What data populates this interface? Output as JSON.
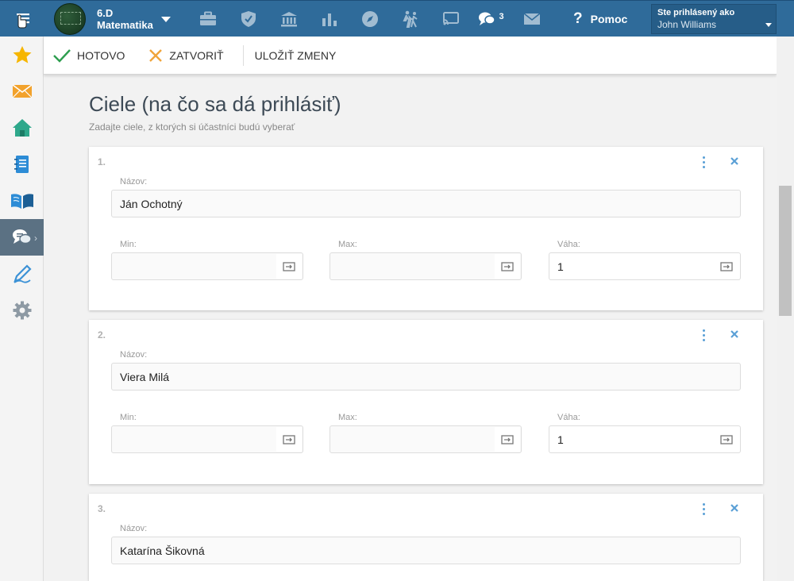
{
  "colors": {
    "topbar": "#2f6b9a",
    "accent": "#5a9fd6",
    "done": "#2e9e4f",
    "close": "#f0a43a"
  },
  "header": {
    "class_line1": "6.D",
    "class_line2": "Matematika",
    "messages_count": "3",
    "help_label": "Pomoc",
    "user_caption": "Ste prihlásený ako",
    "user_name": "John Williams",
    "nav_icons": [
      "briefcase-icon",
      "shield-icon",
      "bank-icon",
      "bar-chart-icon",
      "compass-icon",
      "hiking-icon",
      "cast-icon",
      "chat-icon",
      "mail-icon"
    ]
  },
  "sidebar": {
    "items": [
      "star-icon",
      "envelope-icon",
      "home-icon",
      "notebook-icon",
      "book-icon",
      "chat-icon",
      "pen-icon",
      "gear-icon"
    ],
    "active_index": 5
  },
  "toolbar": {
    "done_label": "HOTOVO",
    "close_label": "ZATVORIŤ",
    "save_label": "ULOŽIŤ ZMENY"
  },
  "main": {
    "title": "Ciele (na čo sa dá prihlásiť)",
    "subtitle": "Zadajte ciele, z ktorých si účastníci budú vyberať",
    "labels": {
      "name": "Názov:",
      "min": "Min:",
      "max": "Max:",
      "weight": "Váha:"
    },
    "items": [
      {
        "number": "1.",
        "name": "Ján Ochotný",
        "min": "",
        "max": "",
        "weight": "1"
      },
      {
        "number": "2.",
        "name": "Viera Milá",
        "min": "",
        "max": "",
        "weight": "1"
      },
      {
        "number": "3.",
        "name": "Katarína Šikovná",
        "min": "",
        "max": "",
        "weight": ""
      }
    ]
  }
}
